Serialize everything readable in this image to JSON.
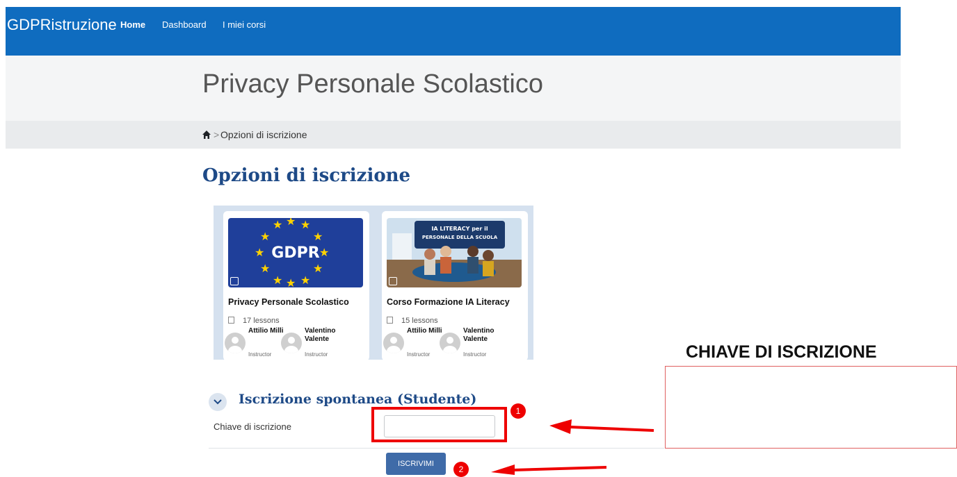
{
  "navbar": {
    "brand": "GDPRistruzione",
    "links": [
      "Home",
      "Dashboard",
      "I miei corsi"
    ]
  },
  "header": {
    "title": "Privacy Personale Scolastico",
    "breadcrumb_sep": ">",
    "breadcrumb_current": "Opzioni di iscrizione"
  },
  "section_title": "Opzioni di iscrizione",
  "courses": [
    {
      "title": "Privacy Personale Scolastico",
      "lessons": "17 lessons",
      "image_text": "GDPR",
      "instructors": [
        {
          "name": "Attilio Milli",
          "role": "Instructor"
        },
        {
          "name": "Valentino Valente",
          "role": "Instructor"
        }
      ]
    },
    {
      "title": "Corso Formazione IA Literacy",
      "lessons": "15 lessons",
      "image_text_1": "IA LITERACY per il",
      "image_text_2": "PERSONALE DELLA SCUOLA",
      "instructors": [
        {
          "name": "Attilio Milli",
          "role": "Instructor"
        },
        {
          "name": "Valentino Valente",
          "role": "Instructor"
        }
      ]
    }
  ],
  "enrolment": {
    "title": "Iscrizione spontanea (Studente)",
    "key_label": "Chiave di iscrizione",
    "key_value": "",
    "submit_label": "ISCRIVIMI"
  },
  "annotations": {
    "badge_1": "1",
    "badge_2": "2",
    "side_heading": "CHIAVE DI ISCRIZIONE"
  },
  "colors": {
    "navbar": "#0f6cbf",
    "heading_blue": "#1e4a87",
    "annotation_red": "#e00000"
  }
}
